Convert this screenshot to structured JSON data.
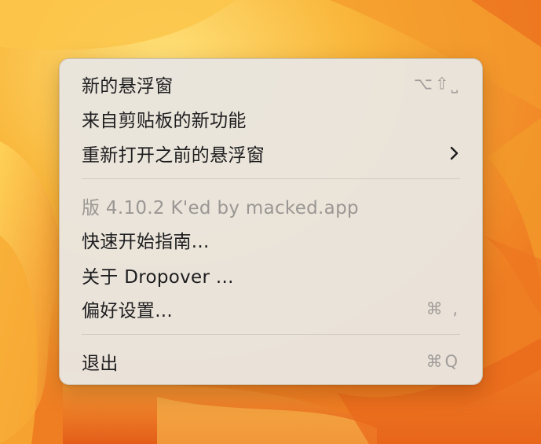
{
  "menu": {
    "items": [
      {
        "label": "新的悬浮窗",
        "shortcut": "⌥⇧⎵"
      },
      {
        "label": "来自剪贴板的新功能"
      },
      {
        "label": "重新打开之前的悬浮窗",
        "submenu_icon": "chevron-right-icon"
      },
      {
        "label": "版 4.10.2 K'ed by macked.app",
        "disabled": true
      },
      {
        "label": "快速开始指南..."
      },
      {
        "label": "关于 Dropover ..."
      },
      {
        "label": "偏好设置...",
        "shortcut": "⌘ ,"
      },
      {
        "label": "退出",
        "shortcut": "⌘Q"
      }
    ]
  },
  "colors": {
    "wallpaper_light": "#ffd24a",
    "wallpaper_mid": "#f6a22a",
    "wallpaper_dark": "#e9661a",
    "menu_background": "#e9e5df",
    "text": "#1d1d1f",
    "disabled_text": "#9a9693",
    "shortcut_text": "#a19d9a"
  }
}
